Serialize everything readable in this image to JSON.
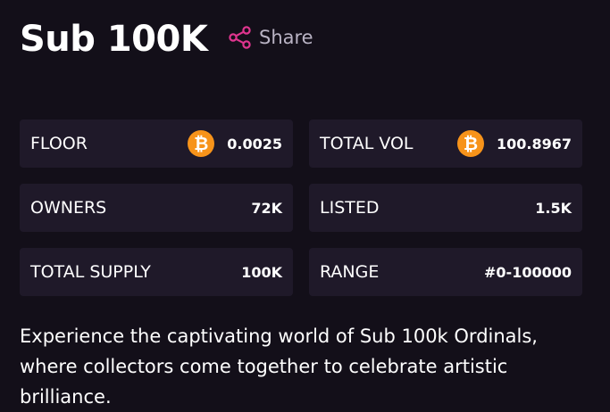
{
  "collection": {
    "title": "Sub 100K",
    "share_label": "Share"
  },
  "stats": [
    {
      "label": "FLOOR",
      "value": "0.0025",
      "icon": "bitcoin-icon"
    },
    {
      "label": "TOTAL VOL",
      "value": "100.8967",
      "icon": "bitcoin-icon"
    },
    {
      "label": "OWNERS",
      "value": "72K"
    },
    {
      "label": "LISTED",
      "value": "1.5K"
    },
    {
      "label": "TOTAL SUPPLY",
      "value": "100K"
    },
    {
      "label": "RANGE",
      "value": "#0-100000"
    }
  ],
  "description": "Experience the captivating world of Sub 100k Ordinals, where collectors come together to celebrate artistic brilliance.",
  "colors": {
    "background": "#130f19",
    "card": "#1f1929",
    "accent": "#e0358f",
    "bitcoin": "#f7931a"
  }
}
